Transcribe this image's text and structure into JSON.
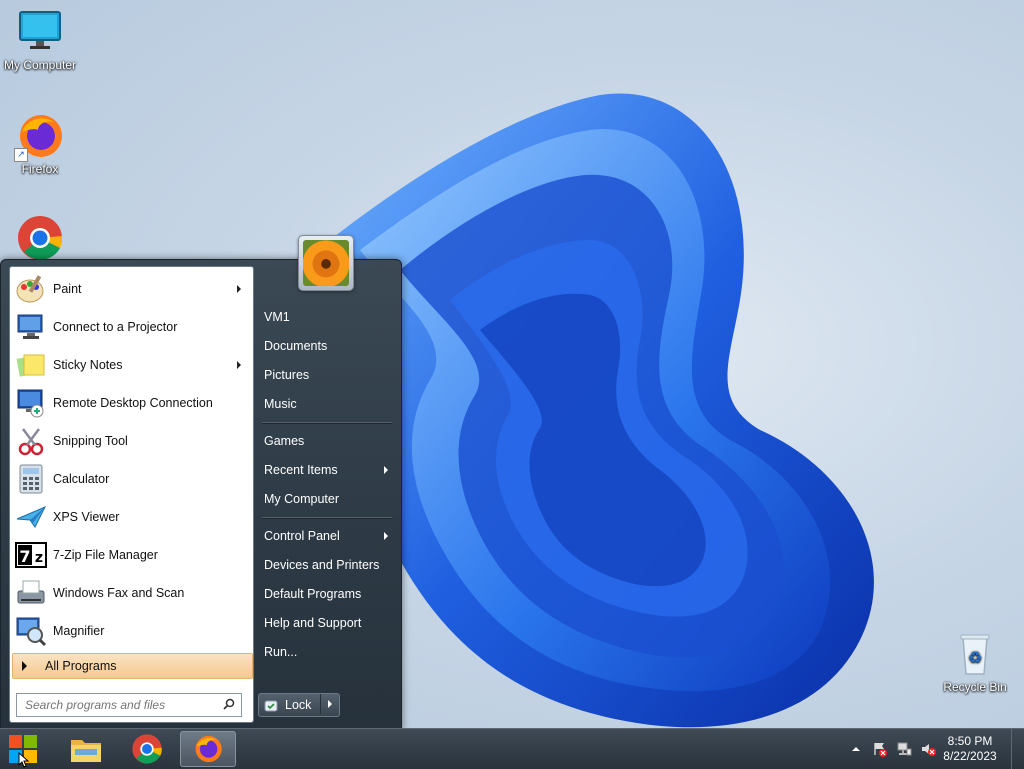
{
  "desktop": {
    "icons": [
      {
        "label": "My Computer"
      },
      {
        "label": "Firefox"
      },
      {
        "label": "Recycle Bin"
      }
    ]
  },
  "start_menu": {
    "programs": [
      {
        "label": "Paint",
        "icon": "paint-icon",
        "has_submenu": true
      },
      {
        "label": "Connect to a Projector",
        "icon": "projector-icon",
        "has_submenu": false
      },
      {
        "label": "Sticky Notes",
        "icon": "sticky-notes-icon",
        "has_submenu": true
      },
      {
        "label": "Remote Desktop Connection",
        "icon": "remote-desktop-icon",
        "has_submenu": false
      },
      {
        "label": "Snipping Tool",
        "icon": "scissors-icon",
        "has_submenu": false
      },
      {
        "label": "Calculator",
        "icon": "calculator-icon",
        "has_submenu": false
      },
      {
        "label": "XPS Viewer",
        "icon": "xps-viewer-icon",
        "has_submenu": false
      },
      {
        "label": "7-Zip File Manager",
        "icon": "seven-zip-icon",
        "has_submenu": false
      },
      {
        "label": "Windows Fax and Scan",
        "icon": "fax-icon",
        "has_submenu": false
      },
      {
        "label": "Magnifier",
        "icon": "magnifier-icon",
        "has_submenu": false
      }
    ],
    "all_programs": "All Programs",
    "search_placeholder": "Search programs and files",
    "places": [
      {
        "label": "VM1"
      },
      {
        "label": "Documents"
      },
      {
        "label": "Pictures"
      },
      {
        "label": "Music"
      },
      {
        "label": "Games"
      },
      {
        "label": "Recent Items",
        "has_submenu": true
      },
      {
        "label": "My Computer"
      },
      {
        "label": "Control Panel",
        "has_submenu": true
      },
      {
        "label": "Devices and Printers"
      },
      {
        "label": "Default Programs"
      },
      {
        "label": "Help and Support"
      },
      {
        "label": "Run..."
      }
    ],
    "lock_label": "Lock"
  },
  "taskbar": {
    "clock_time": "8:50 PM",
    "clock_date": "8/22/2023"
  },
  "colors": {
    "accent_highlight": "#f4c98e",
    "menu_dark": "#2d3a45",
    "wallpaper_blue": "#1f5fe0"
  }
}
